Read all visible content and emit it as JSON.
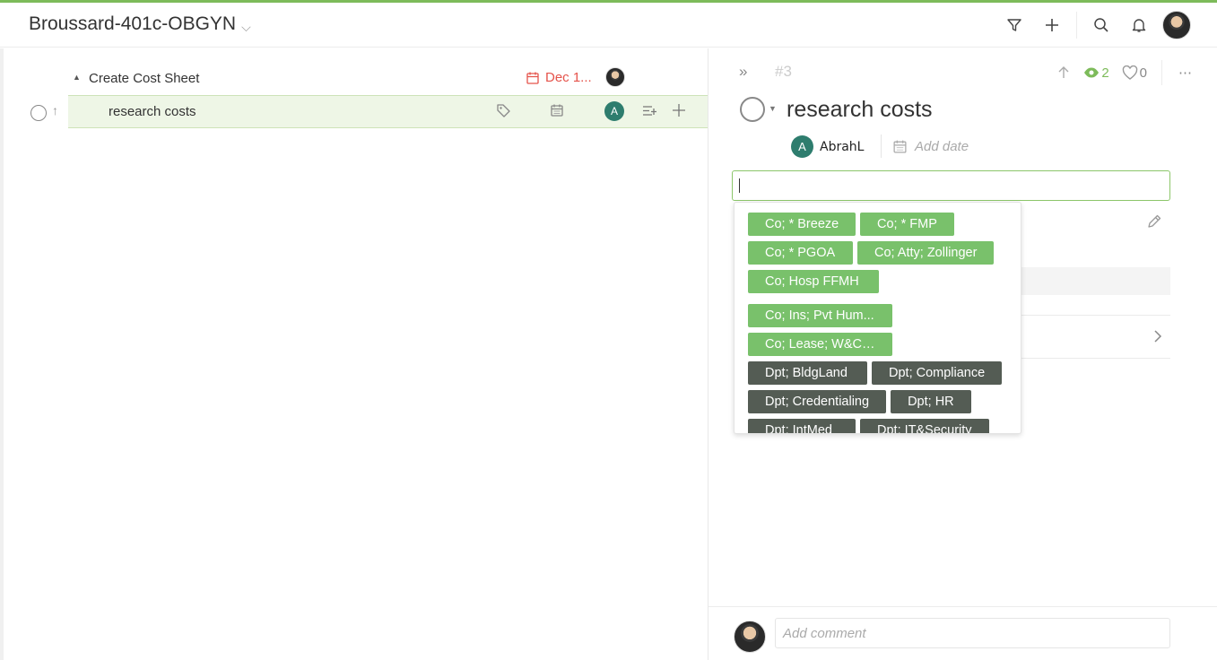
{
  "header": {
    "project_title": "Broussard-401c-OBGYN",
    "icons": [
      "filter-icon",
      "plus-icon",
      "search-icon",
      "bell-icon",
      "user-avatar"
    ]
  },
  "task_list": {
    "parent": {
      "title": "Create Cost Sheet",
      "due": "Dec 1..."
    },
    "child": {
      "title": "research costs",
      "assignee_initial": "A"
    }
  },
  "detail": {
    "task_number": "#3",
    "watchers": "2",
    "likes": "0",
    "title": "research costs",
    "assignee": {
      "initial": "A",
      "name": "AbrahL"
    },
    "add_date_label": "Add date",
    "tag_input_value": "",
    "tags": [
      {
        "label": "Co; * Breeze",
        "kind": "green"
      },
      {
        "label": "Co; * FMP",
        "kind": "green"
      },
      {
        "label": "Co; * PGOA",
        "kind": "green"
      },
      {
        "label": "Co; Atty; Zollinger",
        "kind": "green"
      },
      {
        "label": "Co; Hosp FFMH",
        "kind": "green"
      },
      {
        "label": "Co; Ins; Pvt Hum...",
        "kind": "green"
      },
      {
        "label": "Co; Lease; W&C ...",
        "kind": "green"
      },
      {
        "label": "Dpt; BldgLand",
        "kind": "dark"
      },
      {
        "label": "Dpt; Compliance",
        "kind": "dark"
      },
      {
        "label": "Dpt; Credentialing",
        "kind": "dark"
      },
      {
        "label": "Dpt; HR",
        "kind": "dark"
      },
      {
        "label": "Dpt; IntMed",
        "kind": "dark"
      },
      {
        "label": "Dpt; IT&Security",
        "kind": "dark"
      }
    ],
    "comment_placeholder": "Add comment"
  },
  "colors": {
    "accent_green": "#7dbb5a",
    "tag_green": "#79c16b",
    "tag_dark": "#545c54",
    "due_red": "#e5534b",
    "assignee_teal": "#2e7d6e"
  }
}
